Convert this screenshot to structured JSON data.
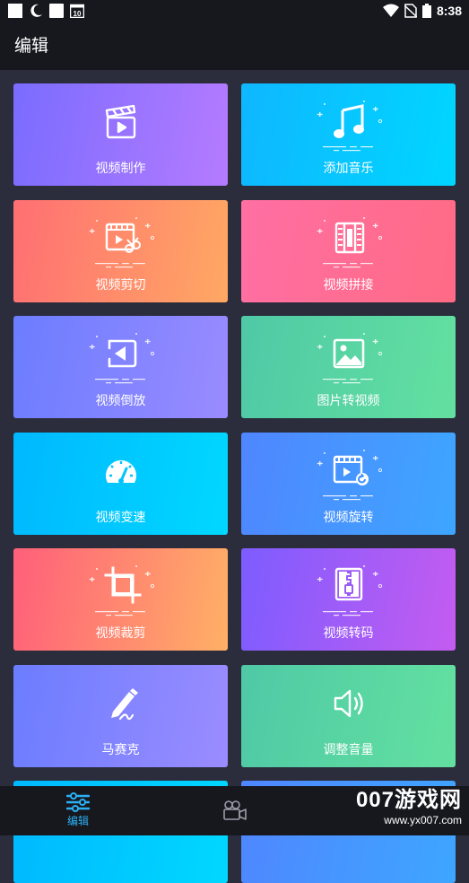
{
  "status_bar": {
    "time": "8:38",
    "left_icons": [
      "square-icon",
      "moon-icon",
      "square-icon",
      "calendar-icon"
    ],
    "calendar_day": "10",
    "right_icons": [
      "wifi-icon",
      "no-sim-icon",
      "battery-icon"
    ]
  },
  "app_bar": {
    "title": "编辑"
  },
  "tiles": [
    {
      "label": "视频制作",
      "icon": "clapperboard-icon",
      "gradient": [
        "#7a6cff",
        "#b57bff"
      ]
    },
    {
      "label": "添加音乐",
      "icon": "music-note-icon",
      "gradient": [
        "#0fb7ff",
        "#00d6ff"
      ]
    },
    {
      "label": "视频剪切",
      "icon": "video-scissors-icon",
      "gradient": [
        "#ff6f73",
        "#ffa863"
      ]
    },
    {
      "label": "视频拼接",
      "icon": "film-strip-icon",
      "gradient": [
        "#ff6fa3",
        "#ff6b85"
      ]
    },
    {
      "label": "视频倒放",
      "icon": "rewind-icon",
      "gradient": [
        "#6b7dff",
        "#9a8bff"
      ]
    },
    {
      "label": "图片转视频",
      "icon": "image-icon",
      "gradient": [
        "#4fc9a6",
        "#63e0a0"
      ]
    },
    {
      "label": "视频变速",
      "icon": "speedometer-icon",
      "gradient": [
        "#00b8ff",
        "#00d8ff"
      ]
    },
    {
      "label": "视频旋转",
      "icon": "video-rotate-icon",
      "gradient": [
        "#4f86ff",
        "#3ea6ff"
      ]
    },
    {
      "label": "视频裁剪",
      "icon": "crop-icon",
      "gradient": [
        "#ff5f7a",
        "#ffb066"
      ]
    },
    {
      "label": "视频转码",
      "icon": "zip-file-icon",
      "gradient": [
        "#7d5cff",
        "#c45cf0"
      ]
    },
    {
      "label": "马赛克",
      "icon": "pen-icon",
      "gradient": [
        "#6b7dff",
        "#9b8cff"
      ]
    },
    {
      "label": "调整音量",
      "icon": "speaker-icon",
      "gradient": [
        "#4fc9a6",
        "#63e0a0"
      ]
    },
    {
      "label": "",
      "icon": "",
      "gradient": [
        "#00b8ff",
        "#00d8ff"
      ]
    },
    {
      "label": "",
      "icon": "",
      "gradient": [
        "#4f86ff",
        "#3ea6ff"
      ]
    }
  ],
  "bottom_nav": {
    "items": [
      {
        "label": "编辑",
        "icon": "sliders-icon",
        "active": true,
        "color": "#2ab0f5"
      },
      {
        "label": "",
        "icon": "video-camera-icon",
        "active": false,
        "color": "#9a9ca8"
      }
    ]
  },
  "watermark": {
    "main": "007游戏网",
    "sub": "www.yx007.com"
  }
}
